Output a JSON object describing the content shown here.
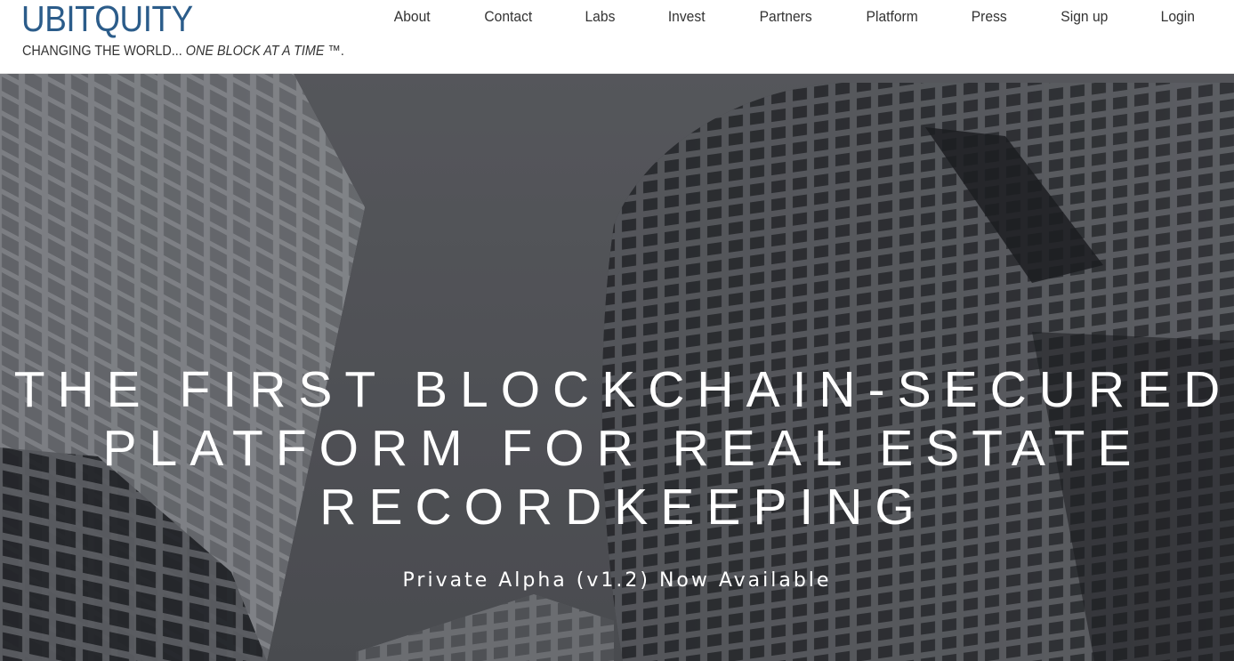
{
  "header": {
    "logo": "UBITQUITY",
    "tagline_plain": "CHANGING THE WORLD...",
    "tagline_italic": "ONE BLOCK AT A TIME",
    "tagline_suffix": "™.",
    "logo_color": "#2b5c8a"
  },
  "nav": {
    "items": [
      {
        "label": "About"
      },
      {
        "label": "Contact"
      },
      {
        "label": "Labs"
      },
      {
        "label": "Invest"
      },
      {
        "label": "Partners"
      },
      {
        "label": "Platform"
      },
      {
        "label": "Press"
      },
      {
        "label": "Sign up"
      },
      {
        "label": "Login"
      }
    ]
  },
  "hero": {
    "headline_lines": [
      "THE FIRST BLOCKCHAIN-SECURED",
      "PLATFORM FOR REAL ESTATE",
      "RECORDKEEPING"
    ],
    "subheadline": "Private Alpha (v1.2) Now Available",
    "background": "grayscale photo of skyscrapers"
  }
}
